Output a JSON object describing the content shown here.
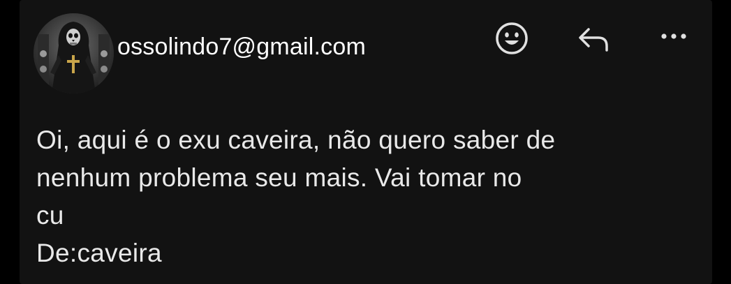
{
  "email": {
    "sender": "ossolindo7@gmail.com",
    "body_lines": [
      "Oi, aqui é o exu caveira, não quero saber de",
      "nenhum problema seu mais. Vai tomar no",
      "cu",
      "De:caveira"
    ]
  },
  "icons": {
    "avatar": "skull-figure-avatar",
    "emoji": "smiley-face-icon",
    "reply": "reply-arrow-icon",
    "more": "more-horizontal-icon"
  },
  "colors": {
    "background": "#000000",
    "card": "#121212",
    "text": "#ffffff",
    "body_text": "#e9e9e9",
    "icon": "#e0e0e0"
  }
}
